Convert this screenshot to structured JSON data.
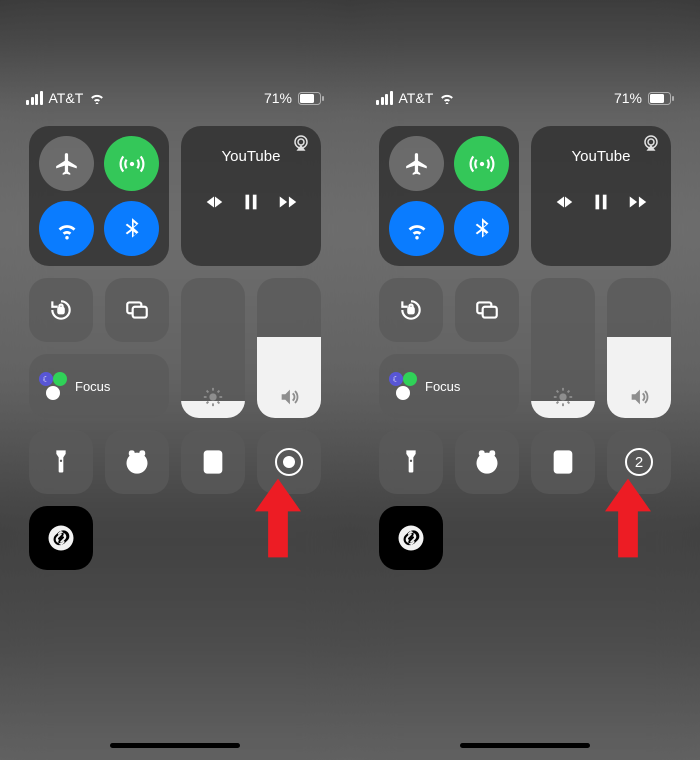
{
  "statusbar": {
    "carrier": "AT&T",
    "battery_pct": "71%"
  },
  "media": {
    "app": "YouTube"
  },
  "focus": {
    "label": "Focus"
  },
  "brightness": {
    "level_pct": 12
  },
  "volume": {
    "level_pct": 58
  },
  "record_countdown": "2"
}
